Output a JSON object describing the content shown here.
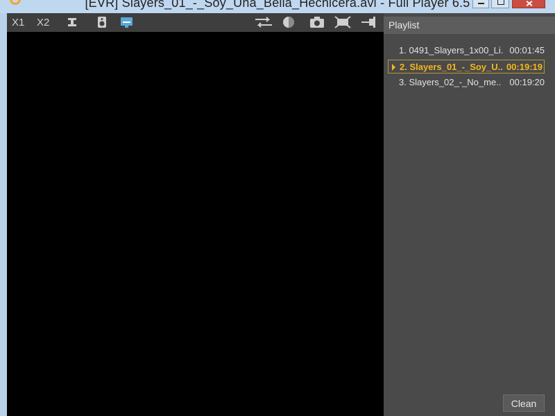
{
  "window": {
    "title": "[EVR] Slayers_01_-_Soy_Una_Bella_Hechicera.avi - Full Player 6.5"
  },
  "toolbar": {
    "zoom1_label": "X1",
    "zoom2_label": "X2",
    "icons": [
      "equalizer-icon",
      "speaker-icon",
      "subtitle-icon",
      "swap-audio-icon",
      "contrast-icon",
      "camera-icon",
      "fullscreen-icon",
      "pin-icon"
    ]
  },
  "playlist": {
    "header": "Playlist",
    "items": [
      {
        "title": "1. 0491_Slayers_1x00_Li..",
        "duration": "00:01:45",
        "active": false
      },
      {
        "title": "2. Slayers_01_-_Soy_U..",
        "duration": "00:19:19",
        "active": true
      },
      {
        "title": "3. Slayers_02_-_No_me..",
        "duration": "00:19:20",
        "active": false
      }
    ],
    "clean_label": "Clean"
  },
  "colors": {
    "active_item": "#f5b61c",
    "panel_bg": "#4a4a4a",
    "toolbar_bg": "#3e3e3e",
    "video_bg": "#000000"
  }
}
